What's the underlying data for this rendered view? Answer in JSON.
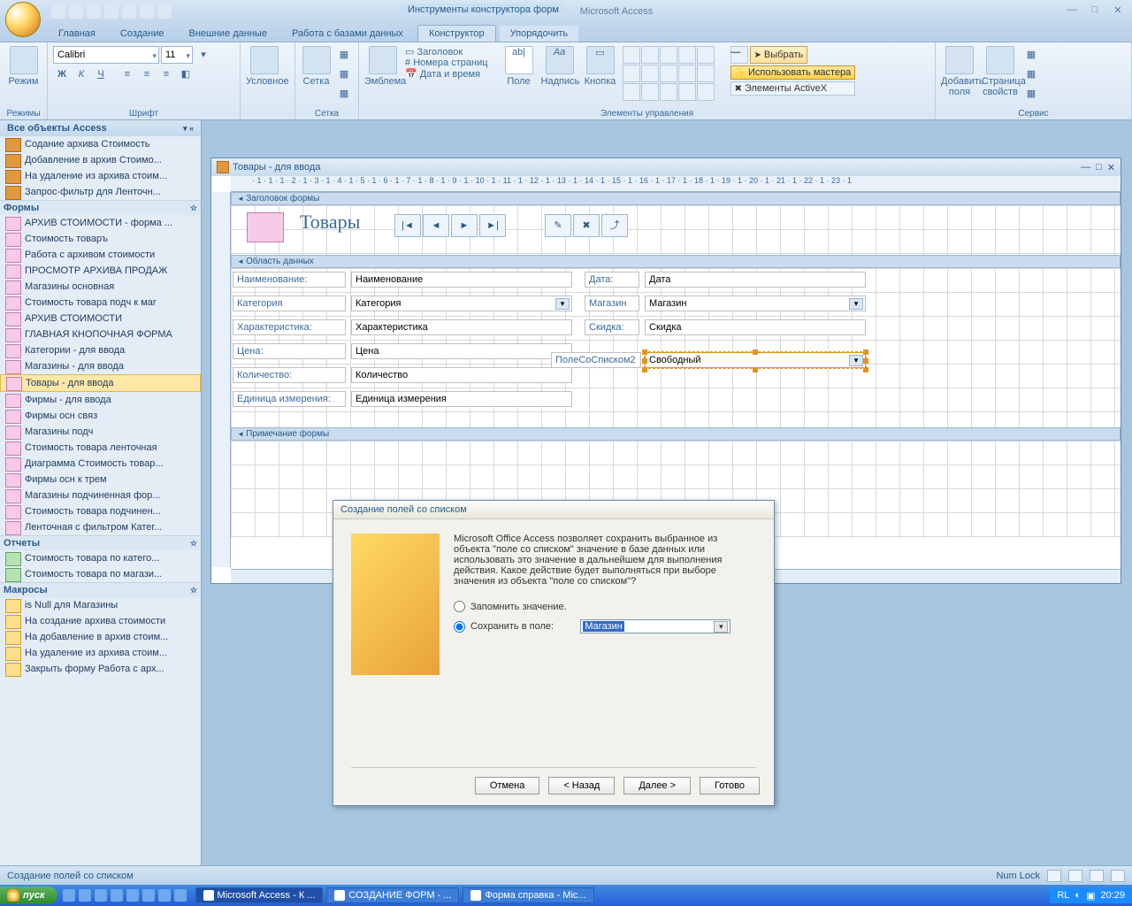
{
  "app": {
    "title": "Microsoft Access",
    "context_title": "Инструменты конструктора форм"
  },
  "tabs": {
    "home": "Главная",
    "create": "Создание",
    "external": "Внешние данные",
    "dbtools": "Работа с базами данных",
    "designer": "Конструктор",
    "arrange": "Упорядочить"
  },
  "ribbon": {
    "mode": "Режим",
    "modes_grp": "Режимы",
    "font": "Calibri",
    "fontsize": "11",
    "font_grp": "Шрифт",
    "cond": "Условное",
    "grid": "Сетка",
    "grid_grp": "Сетка",
    "emblem": "Эмблема",
    "header": "Заголовок",
    "pagenum": "Номера страниц",
    "datetime": "Дата и время",
    "controls_grp": "Элементы управления",
    "field": "Поле",
    "label": "Надпись",
    "button": "Кнопка",
    "select": "Выбрать",
    "usewiz": "Использовать мастера",
    "activex": "Элементы ActiveX",
    "addfields": "Добавить поля",
    "propsheet": "Страница свойств",
    "service_grp": "Сервис"
  },
  "nav": {
    "title": "Все объекты Access",
    "queries": [
      "Содание архива Стоимость",
      "Добавление в архив Стоимо...",
      "На удаление из архива стоим...",
      "Запрос-фильтр для Ленточн..."
    ],
    "forms_grp": "Формы",
    "forms": [
      "АРХИВ СТОИМОСТИ - форма ...",
      "Стоимость товаръ",
      "Работа с архивом стоимости",
      "ПРОСМОТР АРХИВА ПРОДАЖ",
      "Магазины основная",
      "Стоимость товара подч к маг",
      "АРХИВ СТОИМОСТИ",
      "ГЛАВНАЯ КНОПОЧНАЯ ФОРМА",
      "Категории - для ввода",
      "Магазины - для ввода",
      "Товары - для ввода",
      "Фирмы - для ввода",
      "Фирмы осн связ",
      "Магазины подч",
      "Стоимость товара ленточная",
      "Диаграмма Стоимость товар...",
      "Фирмы осн к трем",
      "Магазины подчиненная фор...",
      "Стоимость товара подчинен...",
      "Ленточная с фильтром Катег..."
    ],
    "reports_grp": "Отчеты",
    "reports": [
      "Стоимость товара по катего...",
      "Стоимость товара по магази..."
    ],
    "macros_grp": "Макросы",
    "macros": [
      "is Null для Магазины",
      "На создание архива стоимости",
      "На добавление в архив стоим...",
      "На удаление из архива стоим...",
      "Закрыть форму Работа с арх..."
    ]
  },
  "form": {
    "wintitle": "Товары - для ввода",
    "sec_header": "Заголовок формы",
    "sec_detail": "Область данных",
    "sec_footer": "Примечание формы",
    "title": "Товары",
    "left_fields": [
      {
        "lbl": "Наименование:",
        "ctl": "Наименование"
      },
      {
        "lbl": "Категория",
        "ctl": "Категория",
        "combo": true
      },
      {
        "lbl": "Характеристика:",
        "ctl": "Характеристика"
      },
      {
        "lbl": "Цена:",
        "ctl": "Цена"
      },
      {
        "lbl": "Количество:",
        "ctl": "Количество"
      },
      {
        "lbl": "Единица измерения:",
        "ctl": "Единица измерения"
      }
    ],
    "right_fields": [
      {
        "lbl": "Дата:",
        "ctl": "Дата"
      },
      {
        "lbl": "Магазин",
        "ctl": "Магазин",
        "combo": true
      },
      {
        "lbl": "Скидка:",
        "ctl": "Скидка"
      }
    ],
    "new_combo_lbl": "ПолеСоСписком2",
    "new_combo_ctl": "Свободный",
    "ruler": " · 1 · 1 · 1 · 2 · 1 · 3 · 1 · 4 · 1 · 5 · 1 · 6 · 1 · 7 · 1 · 8 · 1 · 9 · 1 · 10 · 1 · 11 · 1 · 12 · 1 · 13 · 1 · 14 · 1 · 15 · 1 · 16 · 1 · 17 · 1 · 18 · 1 · 19 · 1 · 20 · 1 · 21 · 1 · 22 · 1 · 23 · 1"
  },
  "wizard": {
    "title": "Создание полей со списком",
    "text": "Microsoft Office Access позволяет сохранить выбранное из объекта \"поле со списком\" значение в базе данных или использовать это значение в дальнейшем для выполнения действия.  Какое действие будет выполняться при выборе значения из объекта \"поле со списком\"?",
    "opt1": "Запомнить значение.",
    "opt2": "Сохранить в поле:",
    "combo": "Магазин",
    "cancel": "Отмена",
    "back": "< Назад",
    "next": "Далее >",
    "finish": "Готово"
  },
  "status": {
    "left": "Создание полей со списком",
    "numlock": "Num Lock"
  },
  "taskbar": {
    "start": "пуск",
    "t1": "Microsoft Access - К ...",
    "t2": "СОЗДАНИЕ ФОРМ - ...",
    "t3": "Форма справка - Mic...",
    "lang": "RL",
    "time": "20:29"
  }
}
